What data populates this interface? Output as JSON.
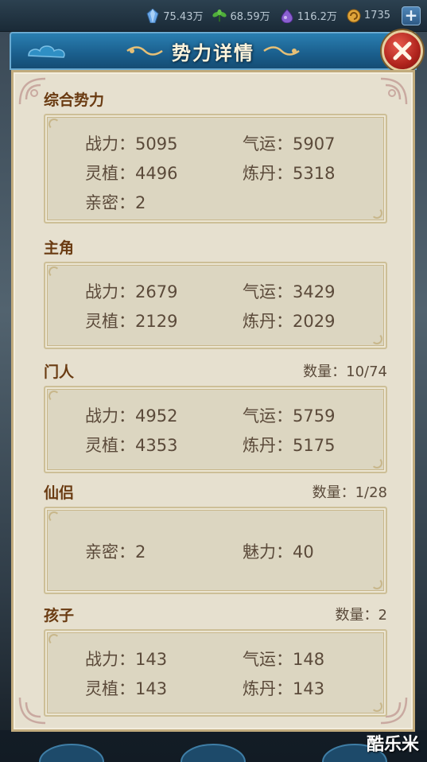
{
  "topbar": {
    "resources": [
      {
        "icon": "crystal-icon",
        "value": "75.43万",
        "color": "#6aa7e8"
      },
      {
        "icon": "herb-icon",
        "value": "68.59万",
        "color": "#4fae3a"
      },
      {
        "icon": "spirit-orb-icon",
        "value": "116.2万",
        "color": "#8a5fd0"
      },
      {
        "icon": "coin-icon",
        "value": "1735",
        "color": "#e0a53a"
      }
    ],
    "add_label": "+"
  },
  "dialog": {
    "title": "势力详情",
    "close_icon": "close-icon"
  },
  "sections": [
    {
      "title": "综合势力",
      "count": "",
      "rows": [
        [
          {
            "label": "战力",
            "value": "5095"
          },
          {
            "label": "气运",
            "value": "5907"
          }
        ],
        [
          {
            "label": "灵植",
            "value": "4496"
          },
          {
            "label": "炼丹",
            "value": "5318"
          }
        ],
        [
          {
            "label": "亲密",
            "value": "2"
          }
        ]
      ]
    },
    {
      "title": "主角",
      "count": "",
      "rows": [
        [
          {
            "label": "战力",
            "value": "2679"
          },
          {
            "label": "气运",
            "value": "3429"
          }
        ],
        [
          {
            "label": "灵植",
            "value": "2129"
          },
          {
            "label": "炼丹",
            "value": "2029"
          }
        ]
      ]
    },
    {
      "title": "门人",
      "count": "数量：10/74",
      "rows": [
        [
          {
            "label": "战力",
            "value": "4952"
          },
          {
            "label": "气运",
            "value": "5759"
          }
        ],
        [
          {
            "label": "灵植",
            "value": "4353"
          },
          {
            "label": "炼丹",
            "value": "5175"
          }
        ]
      ]
    },
    {
      "title": "仙侣",
      "count": "数量：1/28",
      "rows": [
        [
          {
            "label": "亲密",
            "value": "2"
          },
          {
            "label": "魅力",
            "value": "40"
          }
        ]
      ]
    },
    {
      "title": "孩子",
      "count": "数量：2",
      "rows": [
        [
          {
            "label": "战力",
            "value": "143"
          },
          {
            "label": "气运",
            "value": "148"
          }
        ],
        [
          {
            "label": "灵植",
            "value": "143"
          },
          {
            "label": "炼丹",
            "value": "143"
          }
        ]
      ]
    }
  ],
  "watermark": "酷乐米",
  "colors": {
    "title_banner": "#1a5e8c",
    "panel_bg": "#e6e0cf",
    "section_title": "#6a3b12",
    "close_button": "#b0241d"
  }
}
